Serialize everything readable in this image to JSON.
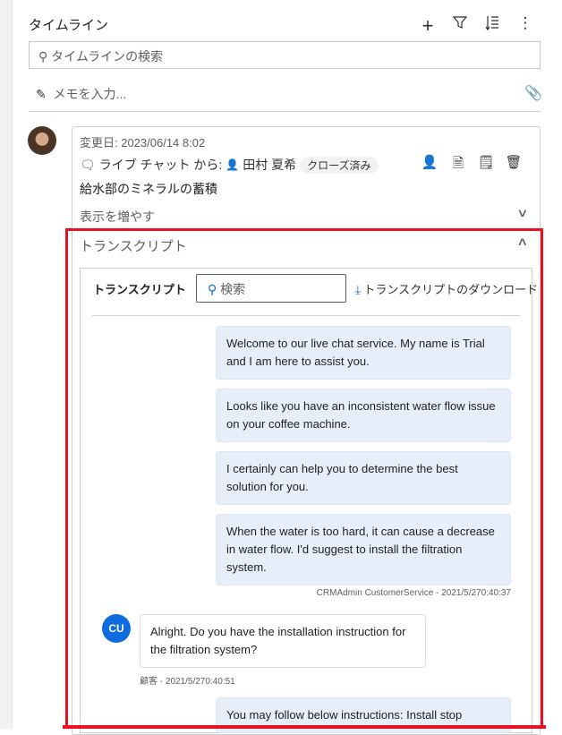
{
  "header": {
    "title": "タイムライン",
    "search_placeholder": "タイムラインの検索",
    "memo_placeholder": "メモを入力..."
  },
  "activity": {
    "modified": "変更日: 2023/06/14 8:02",
    "type": "ライブ チャット から:",
    "user": "田村 夏希",
    "status": "クローズ済み",
    "subject": "給水部のミネラルの蓄積",
    "show_more": "表示を増やす"
  },
  "transcript": {
    "section_title": "トランスクリプト",
    "panel_title": "トランスクリプト",
    "search_placeholder": "検索",
    "download": "トランスクリプトのダウンロード",
    "messages": [
      {
        "text": "Welcome to our live chat service. My name is Trial and I am here to assist you."
      },
      {
        "text": "Looks like you have an inconsistent water flow issue on your coffee machine."
      },
      {
        "text": "I certainly can help you to determine the best solution for you."
      },
      {
        "text": "When the water is too hard, it can cause a decrease in water flow. I'd suggest to install the filtration system."
      }
    ],
    "agent_meta": "CRMAdmin CustomerService - 2021/5/270:40:37",
    "customer_initials": "CU",
    "customer_message": "Alright. Do you have the installation instruction for the filtration system?",
    "customer_meta": "顧客 - 2021/5/270:40:51",
    "last_message": "You may follow below instructions: Install stop"
  }
}
